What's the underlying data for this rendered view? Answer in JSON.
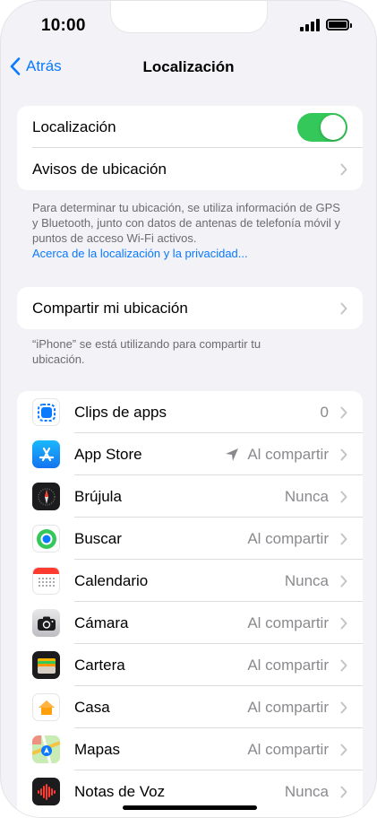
{
  "status_bar": {
    "time": "10:00"
  },
  "nav": {
    "back_label": "Atrás",
    "title": "Localización"
  },
  "location_group": {
    "toggle_label": "Localización",
    "toggle_on": true,
    "alerts_label": "Avisos de ubicación"
  },
  "location_footnote": {
    "text": "Para determinar tu ubicación, se utiliza información de GPS y Bluetooth, junto con datos de antenas de telefonía móvil y puntos de acceso Wi-Fi activos.",
    "link": "Acerca de la localización y la privacidad..."
  },
  "share_group": {
    "label": "Compartir mi ubicación"
  },
  "share_footnote": {
    "text": "“iPhone” se está utilizando para compartir tu ubicación."
  },
  "apps": [
    {
      "name": "Clips de apps",
      "value": "0",
      "icon": "app-clips-icon"
    },
    {
      "name": "App Store",
      "value": "Al compartir",
      "icon": "app-store-icon",
      "arrow": true
    },
    {
      "name": "Brújula",
      "value": "Nunca",
      "icon": "compass-icon"
    },
    {
      "name": "Buscar",
      "value": "Al compartir",
      "icon": "find-my-icon"
    },
    {
      "name": "Calendario",
      "value": "Nunca",
      "icon": "calendar-icon"
    },
    {
      "name": "Cámara",
      "value": "Al compartir",
      "icon": "camera-icon"
    },
    {
      "name": "Cartera",
      "value": "Al compartir",
      "icon": "wallet-icon"
    },
    {
      "name": "Casa",
      "value": "Al compartir",
      "icon": "home-icon"
    },
    {
      "name": "Mapas",
      "value": "Al compartir",
      "icon": "maps-icon"
    },
    {
      "name": "Notas de Voz",
      "value": "Nunca",
      "icon": "voice-memos-icon"
    }
  ],
  "colors": {
    "accent": "#0a7aff",
    "toggle_on": "#34c759",
    "background": "#f2f2f7"
  }
}
